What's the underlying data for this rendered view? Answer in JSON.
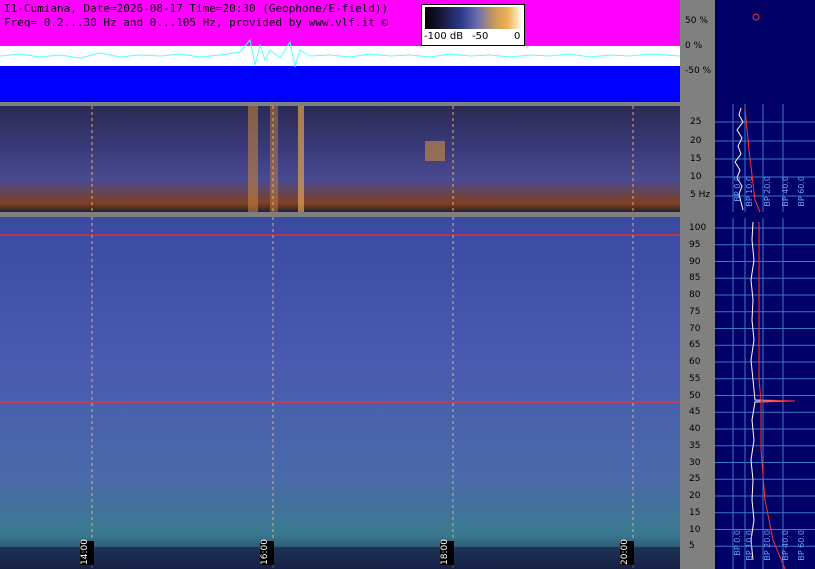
{
  "header": {
    "line1": "I1-Cumiana, Date=2026-08-17 Time=20:30 (Geophone/E-field))",
    "line2": "Freq= 0.2...30 Hz and 0...105 Hz, provided by www.vlf.it ©"
  },
  "colorbar": {
    "min_label": "-100 dB",
    "mid_label": "-50",
    "max_label": "0"
  },
  "top_axis": [
    "50 %",
    "0 %",
    "-50 %"
  ],
  "mid_axis": [
    "25",
    "20",
    "15",
    "10",
    "5 Hz"
  ],
  "bottom_axis": [
    "100",
    "95",
    "90",
    "85",
    "80",
    "75",
    "70",
    "65",
    "60",
    "55",
    "50",
    "45",
    "40",
    "35",
    "30",
    "25",
    "20",
    "15",
    "10",
    "5"
  ],
  "time_labels": [
    "14:00",
    "16:00",
    "18:00",
    "20:00"
  ],
  "bp_labels_top": [
    "BP 0.0",
    "BP 10.0",
    "BP 20.0",
    "BP 40.0",
    "BP 60.0"
  ],
  "bp_labels_bottom": [
    "BP 0.0",
    "BP 10.0",
    "BP 20.0",
    "BP 40.0",
    "BP 60.0"
  ],
  "colors": {
    "magenta": "#ff00ff",
    "blue": "#0000ff",
    "navy": "#000066",
    "gray": "#808080",
    "red_line": "#ff2a2a"
  }
}
